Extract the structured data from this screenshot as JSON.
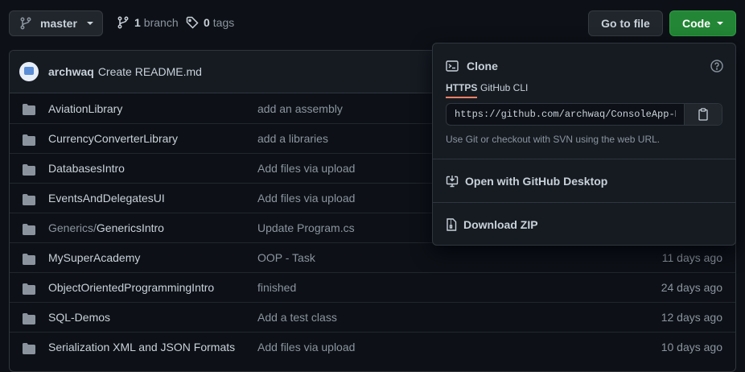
{
  "toolbar": {
    "branch_button": "master",
    "branch_count": "1",
    "branch_word": "branch",
    "tag_count": "0",
    "tag_word": "tags",
    "goto_file": "Go to file",
    "code": "Code"
  },
  "latest_commit": {
    "author": "archwaq",
    "message": "Create README.md"
  },
  "files": [
    {
      "parent": "",
      "name": "AviationLibrary",
      "message": "add an assembly",
      "age": ""
    },
    {
      "parent": "",
      "name": "CurrencyConverterLibrary",
      "message": "add a libraries",
      "age": ""
    },
    {
      "parent": "",
      "name": "DatabasesIntro",
      "message": "Add files via upload",
      "age": ""
    },
    {
      "parent": "",
      "name": "EventsAndDelegatesUI",
      "message": "Add files via upload",
      "age": ""
    },
    {
      "parent": "Generics/",
      "name": "GenericsIntro",
      "message": "Update Program.cs",
      "age": ""
    },
    {
      "parent": "",
      "name": "MySuperAcademy",
      "message": "OOP - Task",
      "age": "11 days ago"
    },
    {
      "parent": "",
      "name": "ObjectOrientedProgrammingIntro",
      "message": "finished",
      "age": "24 days ago"
    },
    {
      "parent": "",
      "name": "SQL-Demos",
      "message": "Add a test class",
      "age": "12 days ago"
    },
    {
      "parent": "",
      "name": "Serialization XML and JSON Formats",
      "message": "Add files via upload",
      "age": "10 days ago"
    }
  ],
  "clone": {
    "title": "Clone",
    "tab_https": "HTTPS",
    "tab_cli": "GitHub CLI",
    "url": "https://github.com/archwaq/ConsoleApp-HW.git",
    "hint": "Use Git or checkout with SVN using the web URL.",
    "open_desktop": "Open with GitHub Desktop",
    "download_zip": "Download ZIP"
  },
  "colors": {
    "background": "#0d1117",
    "code_button": "#238636",
    "active_tab_underline": "#f78166"
  },
  "icons": [
    "branch-icon",
    "tag-icon",
    "folder-icon",
    "terminal-icon",
    "help-icon",
    "copy-icon",
    "desktop-download-icon",
    "zip-icon"
  ]
}
